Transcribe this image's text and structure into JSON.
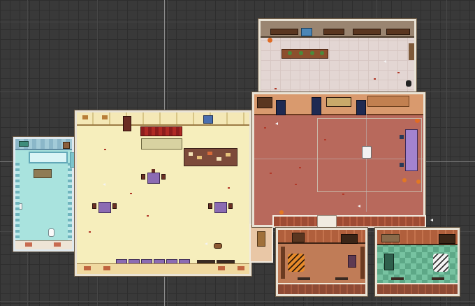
{
  "scene": {
    "type": "top-down tile map editor view",
    "colors": {
      "grid_background": "#393939",
      "hall_floor": "#f6eebc",
      "salon_floor": "#b8695c",
      "kitchen_floor": "#e3d6d3",
      "bath_floor": "#a9e3de",
      "study_floor": "#c07c57",
      "green_room_floor": "#77c3a1",
      "purple_table": "#8b6bb3",
      "dark_wood": "#5a3620"
    },
    "rooms": [
      {
        "id": "bathroom",
        "icon": "bathroom-tile-icon"
      },
      {
        "id": "dining-hall",
        "icon": "dining-table-icon"
      },
      {
        "id": "kitchen",
        "icon": "kitchen-counter-icon"
      },
      {
        "id": "salon",
        "icon": "arcade-cabinet-icon"
      },
      {
        "id": "study",
        "icon": "tiger-rug-icon"
      },
      {
        "id": "green-room",
        "icon": "zebra-rug-icon"
      }
    ]
  }
}
